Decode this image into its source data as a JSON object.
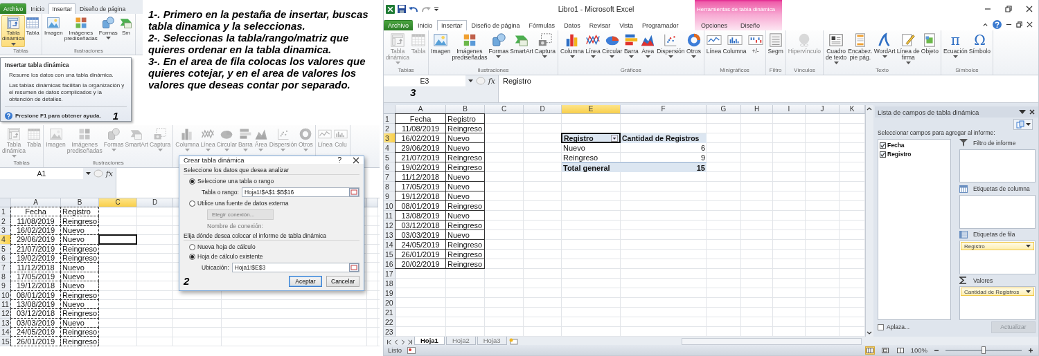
{
  "top_snippet": {
    "tabs": [
      {
        "label": "Archivo",
        "kind": "file",
        "selected": false
      },
      {
        "label": "Inicio",
        "kind": "normal",
        "selected": false
      },
      {
        "label": "Insertar",
        "kind": "normal",
        "selected": true
      },
      {
        "label": "Diseño de página",
        "kind": "normal",
        "selected": false
      }
    ],
    "groups": [
      {
        "label": "Tablas",
        "buttons": [
          {
            "label": "Tabla\ndinámica",
            "caret": true,
            "highlighted": true
          },
          {
            "label": "Tabla",
            "caret": false,
            "highlighted": false
          }
        ]
      },
      {
        "label": "Ilustraciones",
        "buttons": [
          {
            "label": "Imagen",
            "caret": false,
            "highlighted": false
          },
          {
            "label": "Imágenes\nprediseñadas",
            "caret": false,
            "highlighted": false
          },
          {
            "label": "Formas",
            "caret": true,
            "highlighted": false
          },
          {
            "label": "Sm",
            "caret": false,
            "highlighted": false
          }
        ]
      }
    ],
    "tooltip": {
      "title": "Insertar tabla dinámica",
      "summary": "Resume los datos con una tabla dinámica.",
      "detail": "Las tablas dinámicas facilitan la organización y el resumen de datos complicados y la obtención de detalles.",
      "help": "Presione F1 para obtener ayuda.",
      "step": "1"
    }
  },
  "instructions": [
    "1-. Primero en la pestaña de insertar, buscas tabla dinamica y la seleccionas.",
    "2-. Seleccionas la tabla/rango/matriz que quieres ordenar en la tabla dinamica.",
    "3-. En el area de fila colocas los valores que quieres cotejar, y en el area de valores los valores que deseas contar por separado."
  ],
  "left_excel": {
    "ribbon": {
      "groups": [
        {
          "label": "Tablas",
          "buttons": [
            {
              "label": "Tabla\ndinámica",
              "caret": true,
              "disabled": true
            },
            {
              "label": "Tabla",
              "caret": false,
              "disabled": true
            }
          ]
        },
        {
          "label": "Ilustraciones",
          "buttons": [
            {
              "label": "Imagen",
              "caret": false,
              "disabled": true
            },
            {
              "label": "Imágenes\nprediseñadas",
              "caret": false,
              "disabled": true
            },
            {
              "label": "Formas",
              "caret": true,
              "disabled": true
            },
            {
              "label": "SmartArt",
              "caret": false,
              "disabled": true
            },
            {
              "label": "Captura",
              "caret": true,
              "disabled": true
            }
          ]
        },
        {
          "buttons": [
            {
              "label": "Columna",
              "caret": true,
              "disabled": true
            },
            {
              "label": "Línea",
              "caret": true,
              "disabled": true
            },
            {
              "label": "Circular",
              "caret": true,
              "disabled": true
            },
            {
              "label": "Barra",
              "caret": true,
              "disabled": true
            },
            {
              "label": "Área",
              "caret": true,
              "disabled": true
            },
            {
              "label": "Dispersión",
              "caret": true,
              "disabled": true
            },
            {
              "label": "Otros",
              "caret": true,
              "disabled": true
            }
          ]
        },
        {
          "buttons": [
            {
              "label": "Línea",
              "caret": false,
              "disabled": true
            },
            {
              "label": "Colu",
              "caret": false,
              "disabled": true
            }
          ]
        }
      ]
    },
    "name_box": "A1",
    "fx_label": "fx",
    "columns": [
      {
        "label": "A",
        "selected": false
      },
      {
        "label": "B",
        "selected": false
      },
      {
        "label": "C",
        "selected": true
      },
      {
        "label": "D",
        "selected": false
      }
    ],
    "row_headers": [
      {
        "label": "1",
        "selected": false
      },
      {
        "label": "2",
        "selected": false
      },
      {
        "label": "3",
        "selected": false
      },
      {
        "label": "4",
        "selected": true
      },
      {
        "label": "5",
        "selected": false
      },
      {
        "label": "6",
        "selected": false
      },
      {
        "label": "7",
        "selected": false
      },
      {
        "label": "8",
        "selected": false
      },
      {
        "label": "9",
        "selected": false
      },
      {
        "label": "10",
        "selected": false
      },
      {
        "label": "11",
        "selected": false
      },
      {
        "label": "12",
        "selected": false
      },
      {
        "label": "13",
        "selected": false
      },
      {
        "label": "14",
        "selected": false
      },
      {
        "label": "15",
        "selected": false
      }
    ],
    "header": [
      "Fecha",
      "Registro"
    ],
    "data": [
      {
        "fecha": "11/08/2019",
        "registro": "Reingreso"
      },
      {
        "fecha": "16/02/2019",
        "registro": "Nuevo"
      },
      {
        "fecha": "29/06/2019",
        "registro": "Nuevo"
      },
      {
        "fecha": "21/07/2019",
        "registro": "Reingreso"
      },
      {
        "fecha": "19/02/2019",
        "registro": "Reingreso"
      },
      {
        "fecha": "11/12/2018",
        "registro": "Nuevo"
      },
      {
        "fecha": "17/05/2019",
        "registro": "Nuevo"
      },
      {
        "fecha": "19/12/2018",
        "registro": "Nuevo"
      },
      {
        "fecha": "08/01/2019",
        "registro": "Reingreso"
      },
      {
        "fecha": "13/08/2019",
        "registro": "Nuevo"
      },
      {
        "fecha": "03/12/2018",
        "registro": "Reingreso"
      },
      {
        "fecha": "03/03/2019",
        "registro": "Nuevo"
      },
      {
        "fecha": "24/05/2019",
        "registro": "Reingreso"
      },
      {
        "fecha": "26/01/2019",
        "registro": "Reingreso"
      }
    ]
  },
  "dialog": {
    "title": "Crear tabla dinámica",
    "help_label": "?",
    "section_1": "Seleccione los datos que desea analizar",
    "source_options": [
      {
        "label": "Seleccione una tabla o rango",
        "selected": true
      },
      {
        "label": "Utilice una fuente de datos externa",
        "selected": false
      }
    ],
    "range_label": "Tabla o rango:",
    "range_value": "Hoja1!$A$1:$B$16",
    "connection_button": "Elegir conexión...",
    "connection_name": "Nombre de conexión:",
    "section_2": "Elija dónde desea colocar el informe de tabla dinámica",
    "target_options": [
      {
        "label": "Nueva hoja de cálculo",
        "selected": false
      },
      {
        "label": "Hoja de cálculo existente",
        "selected": true
      }
    ],
    "location_label": "Ubicación:",
    "location_value": "Hoja1!$E$3",
    "ok": "Aceptar",
    "cancel": "Cancelar",
    "step": "2"
  },
  "right_excel": {
    "title": "Libro1  -  Microsoft Excel",
    "contextual_header": "Herramientas de tabla dinámica",
    "tabs": [
      {
        "label": "Archivo",
        "kind": "file",
        "selected": false
      },
      {
        "label": "Inicio",
        "kind": "normal",
        "selected": false
      },
      {
        "label": "Insertar",
        "kind": "normal",
        "selected": true
      },
      {
        "label": "Diseño de página",
        "kind": "normal",
        "selected": false
      },
      {
        "label": "Fórmulas",
        "kind": "normal",
        "selected": false
      },
      {
        "label": "Datos",
        "kind": "normal",
        "selected": false
      },
      {
        "label": "Revisar",
        "kind": "normal",
        "selected": false
      },
      {
        "label": "Vista",
        "kind": "normal",
        "selected": false
      },
      {
        "label": "Programador",
        "kind": "normal",
        "selected": false
      },
      {
        "label": "Opciones",
        "kind": "contextual",
        "selected": false
      },
      {
        "label": "Diseño",
        "kind": "contextual",
        "selected": false
      }
    ],
    "ribbon": {
      "groups": [
        {
          "label": "Tablas",
          "buttons": [
            {
              "label": "Tabla\ndinámica",
              "caret": true,
              "disabled": true
            },
            {
              "label": "Tabla",
              "caret": false,
              "disabled": true
            }
          ]
        },
        {
          "label": "Ilustraciones",
          "buttons": [
            {
              "label": "Imagen",
              "caret": false,
              "disabled": false
            },
            {
              "label": "Imágenes\nprediseñadas",
              "caret": false,
              "disabled": false
            },
            {
              "label": "Formas",
              "caret": true,
              "disabled": false
            },
            {
              "label": "SmartArt",
              "caret": false,
              "disabled": false
            },
            {
              "label": "Captura",
              "caret": true,
              "disabled": false
            }
          ]
        },
        {
          "label": "Gráficos",
          "buttons": [
            {
              "label": "Columna",
              "caret": true,
              "disabled": false
            },
            {
              "label": "Línea",
              "caret": true,
              "disabled": false
            },
            {
              "label": "Circular",
              "caret": true,
              "disabled": false
            },
            {
              "label": "Barra",
              "caret": true,
              "disabled": false
            },
            {
              "label": "Área",
              "caret": true,
              "disabled": false
            },
            {
              "label": "Dispersión",
              "caret": true,
              "disabled": false
            },
            {
              "label": "Otros",
              "caret": true,
              "disabled": false
            }
          ]
        },
        {
          "label": "Minigráficos",
          "buttons": [
            {
              "label": "Línea",
              "caret": false,
              "disabled": false
            },
            {
              "label": "Columna",
              "caret": false,
              "disabled": false
            },
            {
              "label": "+/-",
              "caret": false,
              "disabled": false
            }
          ]
        },
        {
          "label": "Filtro",
          "buttons": [
            {
              "label": "Segm",
              "caret": false,
              "disabled": false
            }
          ]
        },
        {
          "label": "Vínculos",
          "buttons": [
            {
              "label": "Hipervínculo",
              "caret": false,
              "disabled": true
            }
          ]
        },
        {
          "label": "Texto",
          "buttons": [
            {
              "label": "Cuadro\nde texto",
              "caret": true,
              "disabled": false
            },
            {
              "label": "Encabez.\npie pág.",
              "caret": false,
              "disabled": false
            },
            {
              "label": "WordArt",
              "caret": true,
              "disabled": false
            },
            {
              "label": "Línea de\nfirma",
              "caret": true,
              "disabled": false
            },
            {
              "label": "Objeto",
              "caret": false,
              "disabled": false
            }
          ]
        },
        {
          "label": "Símbolos",
          "buttons": [
            {
              "label": "Ecuación",
              "caret": true,
              "disabled": false,
              "glyph": "π"
            },
            {
              "label": "Símbolo",
              "caret": false,
              "disabled": false,
              "glyph": "Ω"
            }
          ]
        }
      ]
    },
    "name_box": "E3",
    "fx_label": "fx",
    "formula": "Registro",
    "step": "3",
    "columns": [
      {
        "label": "A",
        "selected": false
      },
      {
        "label": "B",
        "selected": false
      },
      {
        "label": "C",
        "selected": false
      },
      {
        "label": "D",
        "selected": false
      },
      {
        "label": "E",
        "selected": true
      },
      {
        "label": "F",
        "selected": false
      },
      {
        "label": "G",
        "selected": false
      },
      {
        "label": "H",
        "selected": false
      },
      {
        "label": "I",
        "selected": false
      },
      {
        "label": "J",
        "selected": false
      },
      {
        "label": "K",
        "selected": false
      }
    ],
    "row_headers": [
      {
        "label": "1",
        "selected": false
      },
      {
        "label": "2",
        "selected": false
      },
      {
        "label": "3",
        "selected": true
      },
      {
        "label": "4",
        "selected": false
      },
      {
        "label": "5",
        "selected": false
      },
      {
        "label": "6",
        "selected": false
      },
      {
        "label": "7",
        "selected": false
      },
      {
        "label": "8",
        "selected": false
      },
      {
        "label": "9",
        "selected": false
      },
      {
        "label": "10",
        "selected": false
      },
      {
        "label": "11",
        "selected": false
      },
      {
        "label": "12",
        "selected": false
      },
      {
        "label": "13",
        "selected": false
      },
      {
        "label": "14",
        "selected": false
      },
      {
        "label": "15",
        "selected": false
      },
      {
        "label": "16",
        "selected": false
      },
      {
        "label": "17",
        "selected": false
      },
      {
        "label": "18",
        "selected": false
      },
      {
        "label": "19",
        "selected": false
      },
      {
        "label": "20",
        "selected": false
      },
      {
        "label": "21",
        "selected": false
      },
      {
        "label": "22",
        "selected": false
      },
      {
        "label": "23",
        "selected": false
      }
    ],
    "header": [
      "Fecha",
      "Registro"
    ],
    "data": [
      {
        "fecha": "11/08/2019",
        "registro": "Reingreso"
      },
      {
        "fecha": "16/02/2019",
        "registro": "Nuevo"
      },
      {
        "fecha": "29/06/2019",
        "registro": "Nuevo"
      },
      {
        "fecha": "21/07/2019",
        "registro": "Reingreso"
      },
      {
        "fecha": "19/02/2019",
        "registro": "Reingreso"
      },
      {
        "fecha": "11/12/2018",
        "registro": "Nuevo"
      },
      {
        "fecha": "17/05/2019",
        "registro": "Nuevo"
      },
      {
        "fecha": "19/12/2018",
        "registro": "Nuevo"
      },
      {
        "fecha": "08/01/2019",
        "registro": "Reingreso"
      },
      {
        "fecha": "13/08/2019",
        "registro": "Nuevo"
      },
      {
        "fecha": "03/12/2018",
        "registro": "Reingreso"
      },
      {
        "fecha": "03/03/2019",
        "registro": "Nuevo"
      },
      {
        "fecha": "24/05/2019",
        "registro": "Reingreso"
      },
      {
        "fecha": "26/01/2019",
        "registro": "Reingreso"
      },
      {
        "fecha": "20/02/2019",
        "registro": "Reingreso"
      }
    ],
    "pivot_table": {
      "row_field": "Registro",
      "value_field": "Cantidad de Registros",
      "items": [
        {
          "label": "Nuevo",
          "count": "6"
        },
        {
          "label": "Reingreso",
          "count": "9"
        }
      ],
      "total": {
        "label": "Total general",
        "count": "15"
      }
    },
    "field_list": {
      "title": "Lista de campos de tabla dinámica",
      "prompt": "Seleccionar campos para agregar al informe:",
      "fields": [
        {
          "label": "Fecha",
          "checked": true
        },
        {
          "label": "Registro",
          "checked": true
        }
      ],
      "areas": [
        {
          "kind": "filter",
          "label": "Filtro de informe"
        },
        {
          "kind": "columns",
          "label": "Etiquetas de columna"
        },
        {
          "kind": "rows",
          "label": "Etiquetas de fila",
          "items": [
            "Registro"
          ]
        },
        {
          "kind": "values",
          "label": "Valores",
          "items": [
            "Cantidad de Registros"
          ]
        }
      ],
      "defer": {
        "label": "Aplaza...",
        "checked": false
      },
      "update_button": {
        "label": "Actualizar",
        "disabled": true
      }
    },
    "sheet_tabs": [
      {
        "label": "Hoja1",
        "selected": true
      },
      {
        "label": "Hoja2",
        "selected": false
      },
      {
        "label": "Hoja3",
        "selected": false
      }
    ],
    "status": "Listo",
    "views": [
      {
        "selected": true
      },
      {
        "selected": false
      },
      {
        "selected": false
      }
    ],
    "zoom_label": "100%",
    "zoom": {
      "level": 0.5
    }
  }
}
